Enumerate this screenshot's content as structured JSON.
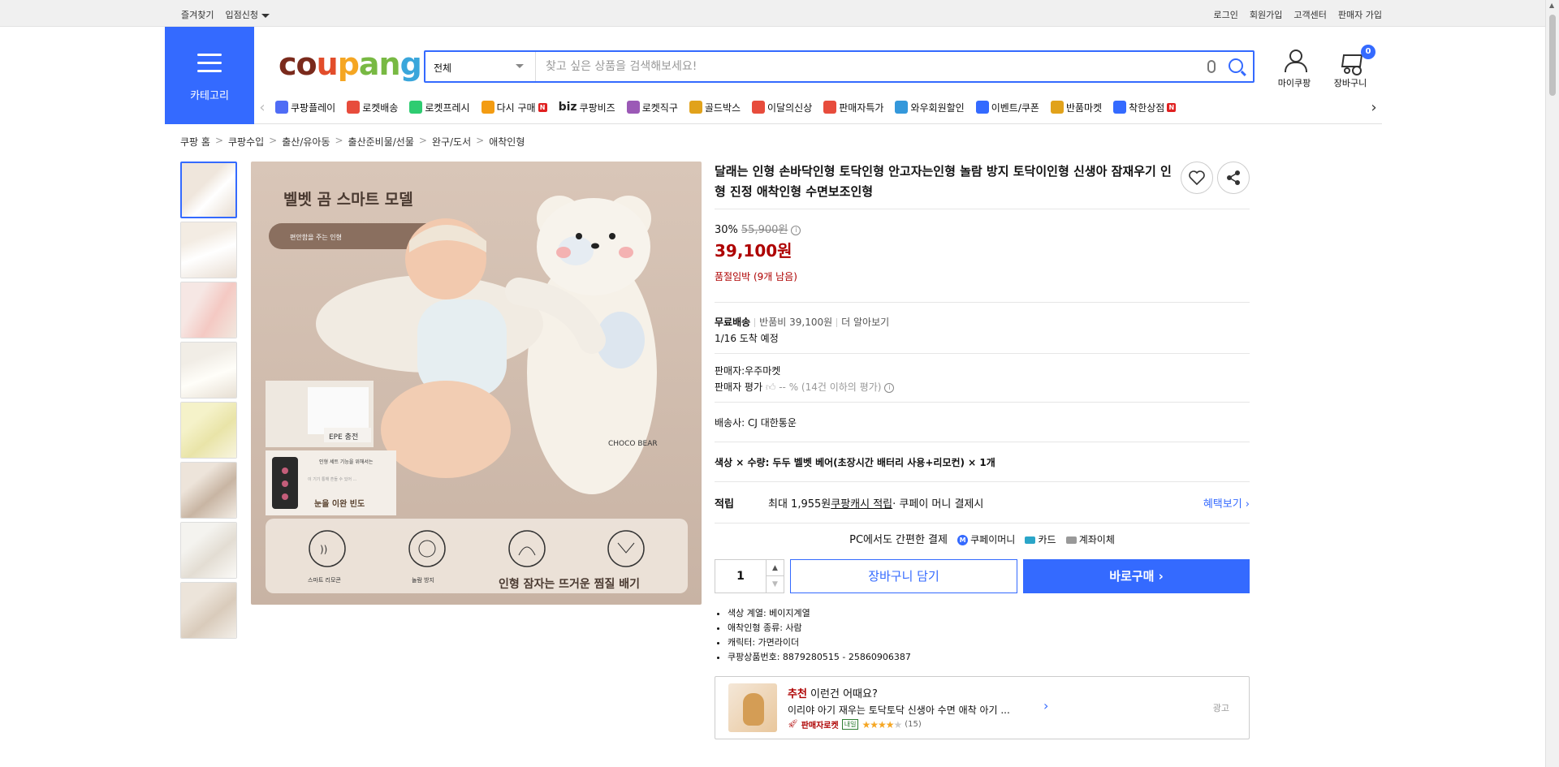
{
  "topbar": {
    "favorites": "즐겨찾기",
    "vendor_apply": "입점신청",
    "login": "로그인",
    "signup": "회원가입",
    "customer_center": "고객센터",
    "seller_signup": "판매자 가입"
  },
  "header": {
    "category_label": "카테고리",
    "logo": {
      "c1": "co",
      "c2": "u",
      "c3": "p",
      "c4": "an",
      "c5": "g"
    },
    "search_category": "전체",
    "search_placeholder": "찾고 싶은 상품을 검색해보세요!",
    "mypage": "마이쿠팡",
    "cart": "장바구니",
    "cart_count": "0"
  },
  "catnav": [
    {
      "label": "쿠팡플레이",
      "color": "#4f6cf5"
    },
    {
      "label": "로켓배송",
      "color": "#e74c3c"
    },
    {
      "label": "로켓프레시",
      "color": "#2ecc71"
    },
    {
      "label": "다시 구매",
      "color": "#f39c12"
    },
    {
      "label": "쿠팡비즈",
      "color": "#222"
    },
    {
      "label": "로켓직구",
      "color": "#9b59b6"
    },
    {
      "label": "골드박스",
      "color": "#e1a21b"
    },
    {
      "label": "이달의신상",
      "color": "#e74c3c"
    },
    {
      "label": "판매자특가",
      "color": "#e74c3c"
    },
    {
      "label": "와우회원할인",
      "color": "#3498db"
    },
    {
      "label": "이벤트/쿠폰",
      "color": "#346aff"
    },
    {
      "label": "반품마켓",
      "color": "#e1a21b"
    },
    {
      "label": "착한상점",
      "color": "#346aff"
    }
  ],
  "catnav_biz_prefix": "biz",
  "badge_new": "N",
  "breadcrumb": [
    "쿠팡 홈",
    "쿠팡수입",
    "출산/유아동",
    "출산준비물/선물",
    "완구/도서",
    "애착인형"
  ],
  "product": {
    "title": "달래는 인형 손바닥인형 토닥인형 안고자는인형 놀람 방지 토닥이인형 신생아 잠재우기 인형 진정 애착인형 수면보조인형",
    "discount_rate": "30%",
    "original_price": "55,900원",
    "price": "39,100원",
    "stock": "품절임박 (9개 남음)",
    "shipping_free": "무료배송",
    "return_fee": "반품비 39,100원",
    "more": "더 알아보기",
    "arrival": "1/16 도착 예정",
    "seller": "판매자:우주마켓",
    "seller_rating_label": "판매자 평가",
    "seller_rating": "-- % (14건 이하의 평가)",
    "courier": "배송사:  CJ 대한통운",
    "option": "색상 × 수량: 두두 벨벳 베어(초장시간 배터리 사용+리모컨) × 1개",
    "reward_label": "적립",
    "reward_text_pre": "최대 1,955원 ",
    "reward_link": "쿠팡캐시 적립",
    "reward_text_post": " · 쿠페이 머니 결제시",
    "benefit": "혜택보기",
    "pc_pay": "PC에서도 간편한 결제",
    "pay_coupay": "쿠페이머니",
    "pay_card": "카드",
    "pay_bank": "계좌이체",
    "coupay_icon_letter": "M",
    "quantity": "1",
    "add_cart": "장바구니 담기",
    "buy_now": "바로구매",
    "attributes": [
      "색상 계열: 베이지계열",
      "애착인형 종류: 사람",
      "캐릭터: 가면라이더",
      "쿠팡상품번호: 8879280515 - 25860906387"
    ]
  },
  "main_image": {
    "title": "벨벳 곰 스마트 모델",
    "pill": "편안함을 주는 인형",
    "bear_label": "CHOCO BEAR",
    "epe": "EPE 충전",
    "card_title": "인형 세트 기능을 위해서는",
    "card_body": "이 기기 통해 흔들 수 있어 ...",
    "card_foot": "눈을 이완 빈도",
    "icons": [
      "스마트 리모콘",
      "놀람 방지",
      "",
      ""
    ],
    "bottom_caption": "인형 잠자는 뜨거운 찜질 배기"
  },
  "recommend": {
    "prefix": "추천",
    "title": " 이런건 어때요?",
    "name": "이리야 아기 재우는 토닥토닥 신생아 수면 애착 아기 ...",
    "badge": "판매자로켓",
    "tag": "내일",
    "rating": "4",
    "reviews": "(15)",
    "ad": "광고"
  },
  "colors": {
    "accent": "#346aff",
    "price_red": "#ae0000"
  }
}
